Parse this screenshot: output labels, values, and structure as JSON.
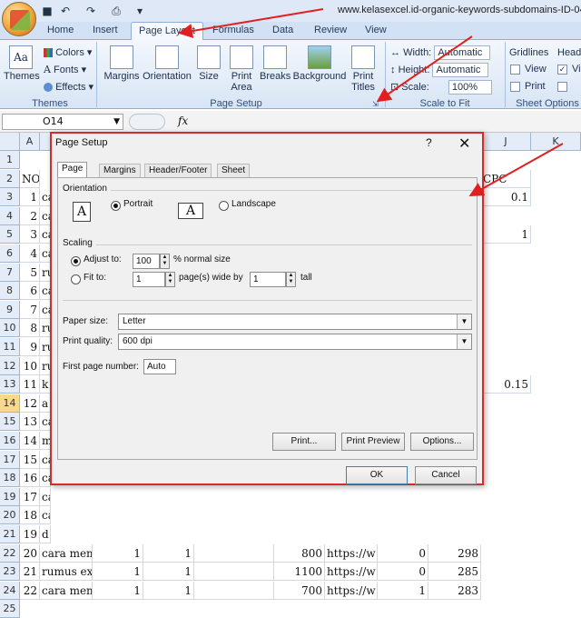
{
  "window": {
    "title": "www.kelasexcel.id-organic-keywords-subdomains-ID-04-"
  },
  "tabs": [
    "Home",
    "Insert",
    "Page Layout",
    "Formulas",
    "Data",
    "Review",
    "View"
  ],
  "ribbon": {
    "themes_group": {
      "themes": "Themes",
      "colors": "Colors",
      "fonts": "Fonts",
      "effects": "Effects",
      "label": "Themes"
    },
    "page_setup_group": {
      "margins": "Margins",
      "orientation": "Orientation",
      "size": "Size",
      "print_area": "Print Area",
      "breaks": "Breaks",
      "background": "Background",
      "print_titles": "Print Titles",
      "label": "Page Setup"
    },
    "scale_group": {
      "width_label": "Width:",
      "width_value": "Automatic",
      "height_label": "Height:",
      "height_value": "Automatic",
      "scale_label": "Scale:",
      "scale_value": "100%",
      "label": "Scale to Fit"
    },
    "sheet_options": {
      "gridlines": "Gridlines",
      "headings": "Headi",
      "view": "View",
      "print": "Print",
      "view2": "Vi",
      "label": "Sheet Options"
    }
  },
  "formula_bar": {
    "name_box": "O14",
    "fx": "fx"
  },
  "columns": [
    "A",
    "J",
    "K"
  ],
  "rows": [
    "1",
    "2",
    "3",
    "4",
    "5",
    "6",
    "7",
    "8",
    "9",
    "10",
    "11",
    "12",
    "13",
    "14",
    "15",
    "16",
    "17",
    "18",
    "19",
    "20",
    "21",
    "22",
    "23",
    "24",
    "25"
  ],
  "cells": {
    "no_header": "NO",
    "cpc_header": "CPC",
    "col_a": [
      "1",
      "2",
      "3",
      "4",
      "5",
      "6",
      "7",
      "8",
      "9",
      "10",
      "11",
      "12",
      "13",
      "14",
      "15",
      "16",
      "17",
      "18",
      "19",
      "20",
      "21",
      "22"
    ],
    "col_b_short": [
      "ca",
      "ca",
      "ca",
      "ca",
      "ru",
      "ca",
      "ca",
      "ru",
      "ru",
      "ru",
      "k",
      "a",
      "ca",
      "m",
      "ca",
      "ca",
      "ca",
      "ca",
      "d"
    ],
    "cpc": {
      "r3": "0.1",
      "r5": "1",
      "r13": "0.15"
    },
    "bottom_rows": [
      {
        "a": "20",
        "b": "cara mem",
        "c": "1",
        "d": "1",
        "f": "800",
        "g": "https://w",
        "h": "0",
        "i": "298"
      },
      {
        "a": "21",
        "b": "rumus exc",
        "c": "1",
        "d": "1",
        "f": "1100",
        "g": "https://w",
        "h": "0",
        "i": "285"
      },
      {
        "a": "22",
        "b": "cara mem",
        "c": "1",
        "d": "1",
        "f": "700",
        "g": "https://w",
        "h": "1",
        "i": "283"
      }
    ]
  },
  "dialog": {
    "title": "Page Setup",
    "help": "?",
    "close": "✕",
    "tabs": [
      "Page",
      "Margins",
      "Header/Footer",
      "Sheet"
    ],
    "orientation_label": "Orientation",
    "portrait": "Portrait",
    "landscape": "Landscape",
    "scaling_label": "Scaling",
    "adjust_to": "Adjust to:",
    "adjust_value": "100",
    "normal_size": "% normal size",
    "fit_to": "Fit to:",
    "fit_wide_value": "1",
    "pages_wide": "page(s) wide by",
    "fit_tall_value": "1",
    "tall": "tall",
    "paper_size_label": "Paper size:",
    "paper_size_value": "Letter",
    "print_quality_label": "Print quality:",
    "print_quality_value": "600 dpi",
    "first_page_label": "First page number:",
    "first_page_value": "Auto",
    "buttons": {
      "print": "Print...",
      "preview": "Print Preview",
      "options": "Options...",
      "ok": "OK",
      "cancel": "Cancel"
    }
  },
  "accent_colors": {
    "annotation_red": "#e02020",
    "ribbon_blue": "#d3e1f4",
    "selected_row": "#f8d88b"
  }
}
